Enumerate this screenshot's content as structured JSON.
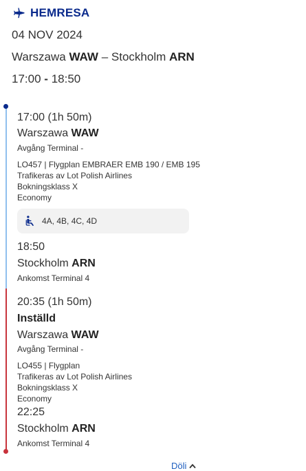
{
  "header": {
    "title": "HEMRESA"
  },
  "trip": {
    "date": "04 NOV 2024",
    "origin_city": "Warszawa",
    "origin_code": "WAW",
    "separator": "–",
    "destination_city": "Stockholm",
    "destination_code": "ARN",
    "depart_time": "17:00",
    "time_sep": "-",
    "arrive_time": "18:50"
  },
  "segments": [
    {
      "dep_time_line": "17:00 (1h 50m)",
      "dep_city": "Warszawa",
      "dep_code": "WAW",
      "dep_terminal": "Avgång Terminal -",
      "flight_info": "LO457 | Flygplan EMBRAER EMB 190 / EMB 195",
      "operated_by": "Trafikeras av Lot Polish Airlines",
      "booking_class": "Bokningsklass X",
      "cabin": "Economy",
      "seats": "4A, 4B, 4C, 4D",
      "arr_time": "18:50",
      "arr_city": "Stockholm",
      "arr_code": "ARN",
      "arr_terminal": "Ankomst Terminal 4"
    },
    {
      "dep_time_line": "20:35 (1h 50m)",
      "status": "Inställd",
      "dep_city": "Warszawa",
      "dep_code": "WAW",
      "dep_terminal": "Avgång Terminal -",
      "flight_info": "LO455 | Flygplan",
      "operated_by": "Trafikeras av Lot Polish Airlines",
      "booking_class": "Bokningsklass X",
      "cabin": "Economy",
      "arr_time": "22:25",
      "arr_city": "Stockholm",
      "arr_code": "ARN",
      "arr_terminal": "Ankomst Terminal 4"
    }
  ],
  "footer": {
    "share_label": "Döli"
  },
  "colors": {
    "brand": "#0a2a8c",
    "timeline_ok": "#8fbfee",
    "timeline_cancelled": "#c8323b",
    "link": "#1f5fbf"
  }
}
